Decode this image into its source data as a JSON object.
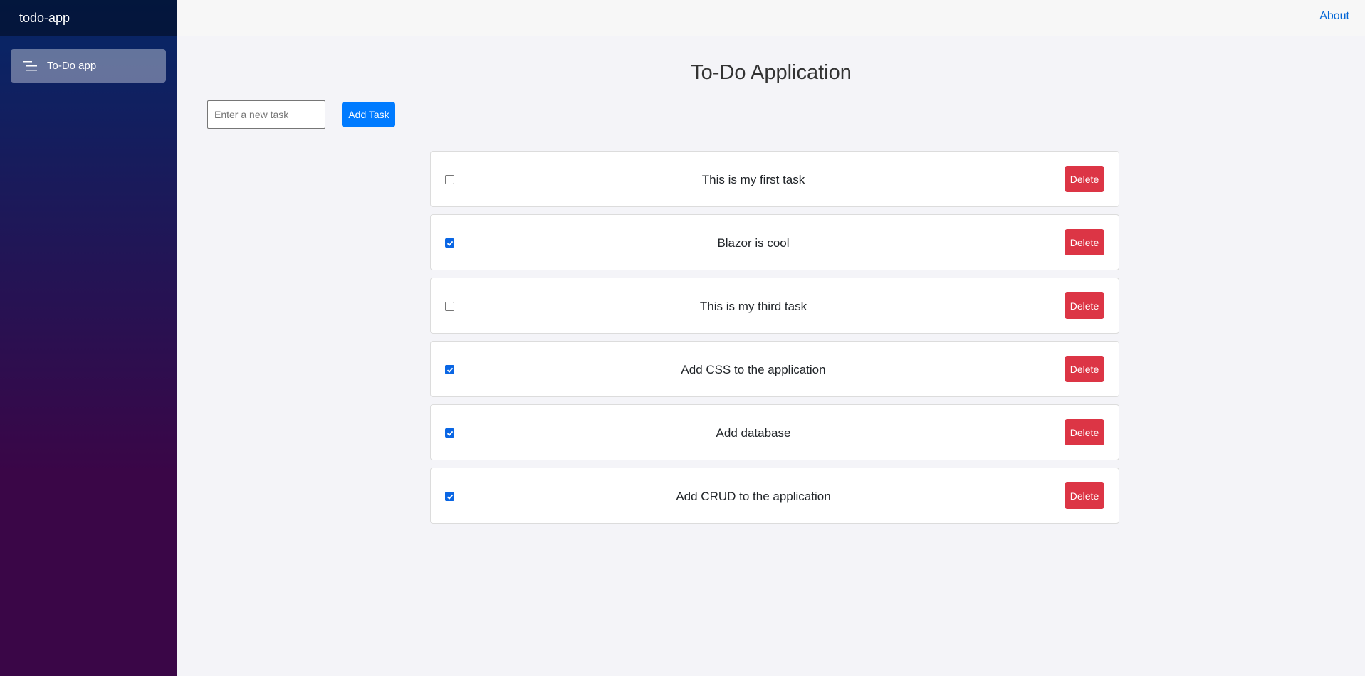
{
  "sidebar": {
    "brand": "todo-app",
    "nav_items": [
      {
        "label": "To-Do app",
        "icon": "list-icon"
      }
    ]
  },
  "topbar": {
    "about_label": "About"
  },
  "main": {
    "title": "To-Do Application",
    "new_task_placeholder": "Enter a new task",
    "new_task_value": "",
    "add_button_label": "Add Task",
    "tasks": [
      {
        "text": "This is my first task",
        "done": false,
        "delete_label": "Delete"
      },
      {
        "text": "Blazor is cool",
        "done": true,
        "delete_label": "Delete"
      },
      {
        "text": "This is my third task",
        "done": false,
        "delete_label": "Delete"
      },
      {
        "text": "Add CSS to the application",
        "done": true,
        "delete_label": "Delete"
      },
      {
        "text": "Add database",
        "done": true,
        "delete_label": "Delete"
      },
      {
        "text": "Add CRUD to the application",
        "done": true,
        "delete_label": "Delete"
      }
    ]
  },
  "colors": {
    "primary": "#007bff",
    "danger": "#dc3545",
    "link": "#0366d6",
    "sidebar_top": "#052767",
    "sidebar_bottom": "#3a0647",
    "checkbox_checked": "#0a66e4"
  }
}
